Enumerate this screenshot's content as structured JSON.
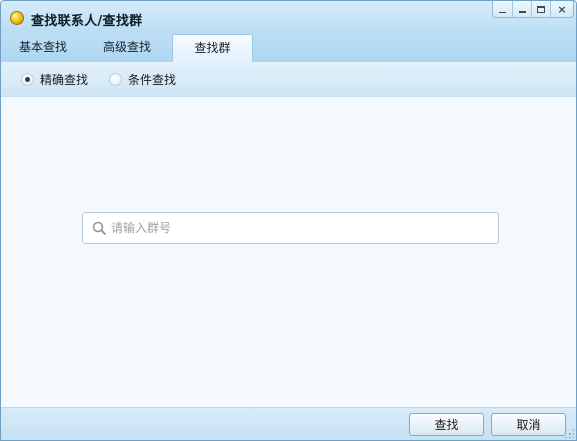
{
  "window": {
    "title": "查找联系人/查找群",
    "controls": {
      "menu": "_",
      "minimize": "",
      "maximize": "",
      "close": "×"
    }
  },
  "tabs": [
    {
      "label": "基本查找",
      "active": false
    },
    {
      "label": "高级查找",
      "active": false
    },
    {
      "label": "查找群",
      "active": true
    }
  ],
  "search_mode": {
    "options": [
      {
        "label": "精确查找",
        "selected": true
      },
      {
        "label": "条件查找",
        "selected": false
      }
    ]
  },
  "search": {
    "value": "",
    "placeholder": "请输入群号",
    "icon": "search-icon"
  },
  "footer": {
    "find_label": "查找",
    "cancel_label": "取消"
  },
  "colors": {
    "title_bar": "#c4e3f7",
    "content_bg": "#f4f9fd",
    "border": "#6f9fc4"
  }
}
